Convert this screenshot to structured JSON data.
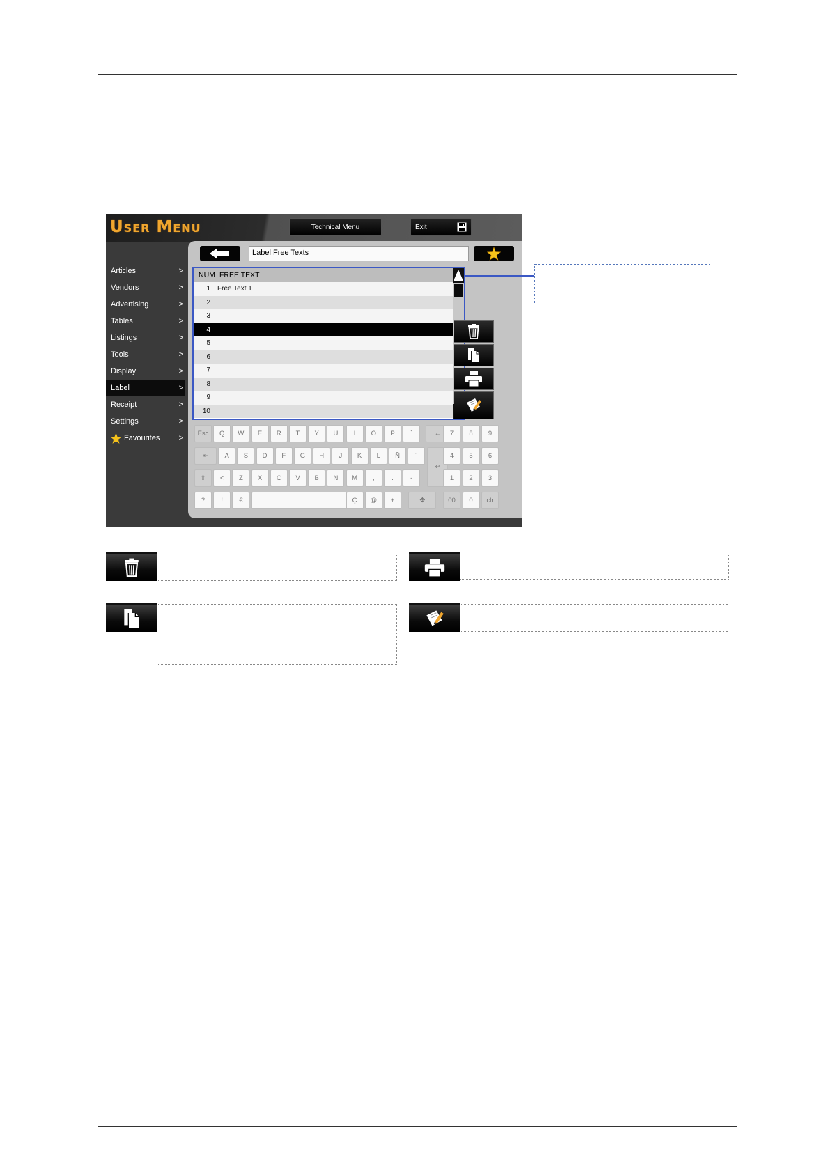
{
  "app": {
    "title": "User Menu",
    "technical_menu_label": "Technical Menu",
    "exit_label": "Exit"
  },
  "sidebar": {
    "items": [
      {
        "label": "Articles",
        "arrow": ">"
      },
      {
        "label": "Vendors",
        "arrow": ">"
      },
      {
        "label": "Advertising",
        "arrow": ">"
      },
      {
        "label": "Tables",
        "arrow": ">"
      },
      {
        "label": "Listings",
        "arrow": ">"
      },
      {
        "label": "Tools",
        "arrow": ">"
      },
      {
        "label": "Display",
        "arrow": ">"
      },
      {
        "label": "Label",
        "arrow": ">",
        "active": true
      },
      {
        "label": "Receipt",
        "arrow": ">"
      },
      {
        "label": "Settings",
        "arrow": ">"
      },
      {
        "label": "Favourites",
        "arrow": ">"
      }
    ]
  },
  "panel": {
    "title": "Label Free Texts"
  },
  "list": {
    "columns": [
      "NUM",
      "FREE TEXT"
    ],
    "rows": [
      {
        "num": "1",
        "text": "Free Text 1"
      },
      {
        "num": "2",
        "text": ""
      },
      {
        "num": "3",
        "text": ""
      },
      {
        "num": "4",
        "text": "",
        "selected": true
      },
      {
        "num": "5",
        "text": ""
      },
      {
        "num": "6",
        "text": ""
      },
      {
        "num": "7",
        "text": ""
      },
      {
        "num": "8",
        "text": ""
      },
      {
        "num": "9",
        "text": ""
      },
      {
        "num": "10",
        "text": ""
      }
    ]
  },
  "keyboard": {
    "row1": [
      "Esc",
      "Q",
      "W",
      "E",
      "R",
      "T",
      "Y",
      "U",
      "I",
      "O",
      "P",
      "`",
      "←"
    ],
    "row2": [
      "⇤",
      "A",
      "S",
      "D",
      "F",
      "G",
      "H",
      "J",
      "K",
      "L",
      "Ñ",
      "´"
    ],
    "row3": [
      "⇧",
      "<",
      "Z",
      "X",
      "C",
      "V",
      "B",
      "N",
      "M",
      ",",
      ".",
      "-"
    ],
    "row4": [
      "?",
      "!",
      "€",
      "",
      "Ç",
      "@",
      "+",
      "✥"
    ],
    "enter": "↵",
    "numpad": [
      [
        "7",
        "8",
        "9"
      ],
      [
        "4",
        "5",
        "6"
      ],
      [
        "1",
        "2",
        "3"
      ],
      [
        "00",
        "0",
        "clr"
      ]
    ]
  },
  "colors": {
    "title_orange": "#f0a62e",
    "selection_border": "#3b58c4"
  },
  "icons": {
    "delete": "trash-icon",
    "copy": "copy-icon",
    "print": "printer-icon",
    "edit": "edit-note-icon",
    "back": "arrow-left-icon",
    "favourite": "star-icon",
    "save": "floppy-icon"
  }
}
